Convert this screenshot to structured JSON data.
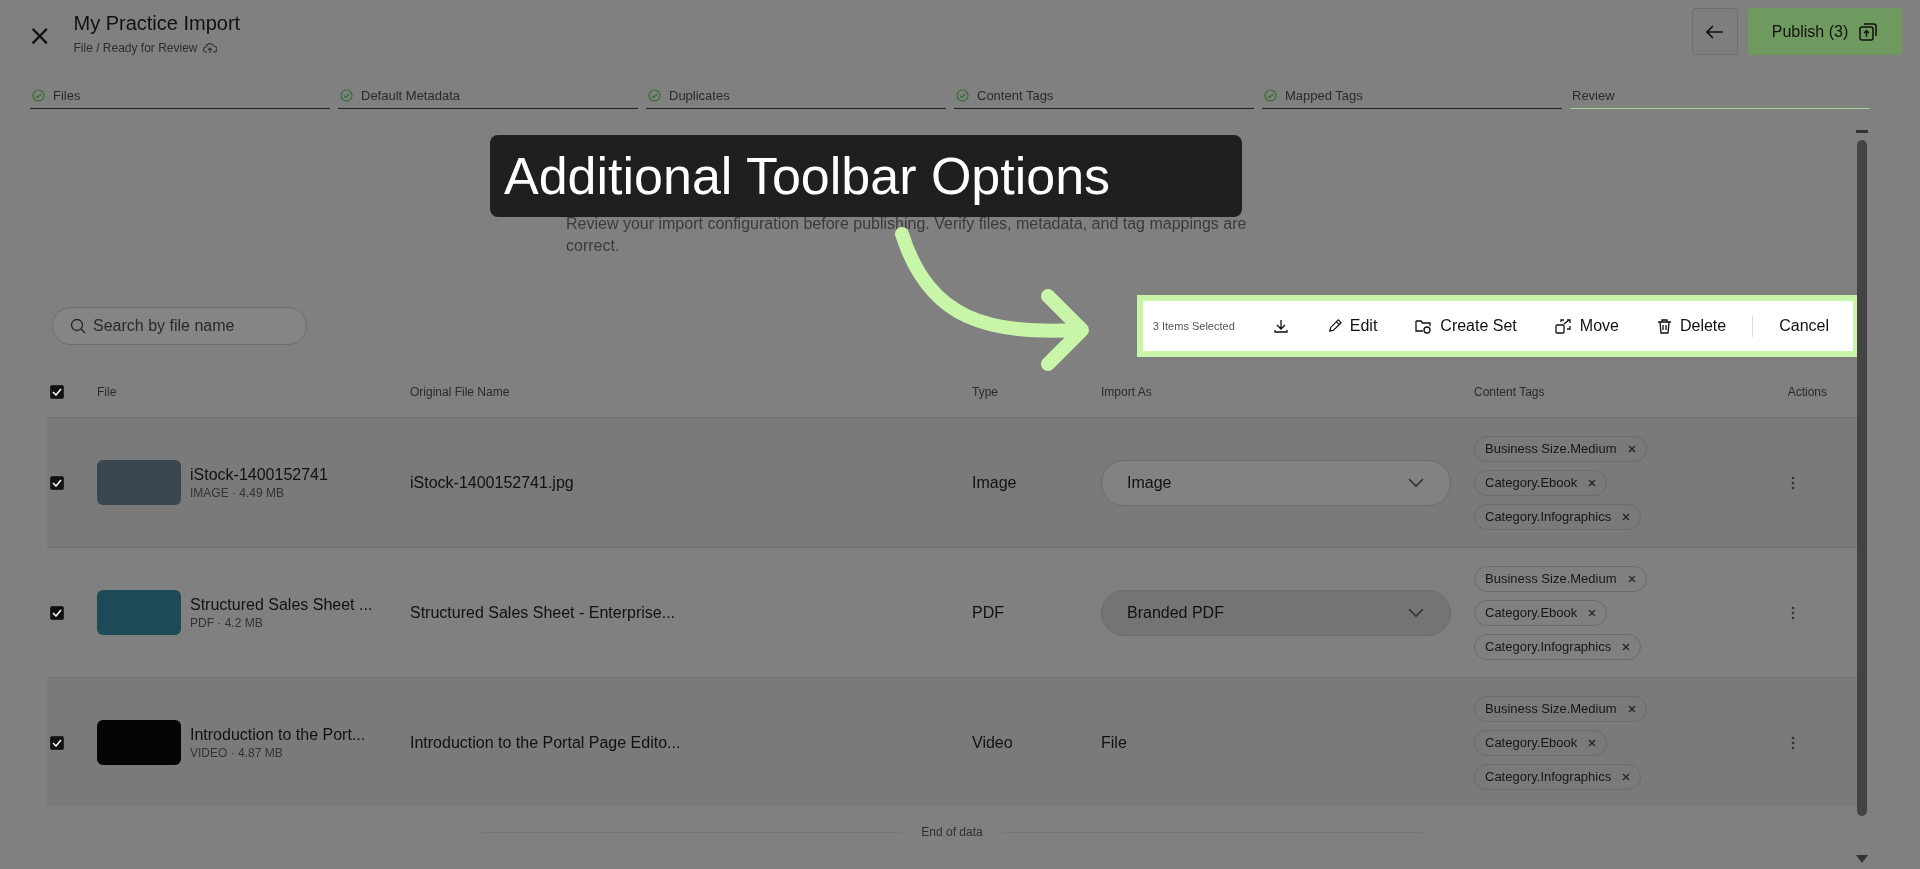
{
  "header": {
    "close": "×",
    "title": "My Practice Import",
    "breadcrumb": "File / Ready for Review",
    "publish_label": "Publish (3)"
  },
  "steps": [
    {
      "label": "Files",
      "done": true,
      "selected": false
    },
    {
      "label": "Default Metadata",
      "done": true,
      "selected": false
    },
    {
      "label": "Duplicates",
      "done": true,
      "selected": false
    },
    {
      "label": "Content Tags",
      "done": true,
      "selected": false
    },
    {
      "label": "Mapped Tags",
      "done": true,
      "selected": false
    },
    {
      "label": "Review",
      "done": false,
      "selected": true
    }
  ],
  "callout": {
    "text": "Additional Toolbar Options"
  },
  "description": "Review your import configuration before publishing. Verify files, metadata, and tag mappings are correct.",
  "search": {
    "placeholder": "Search by file name"
  },
  "toolbar": {
    "selection": "3 Items Selected",
    "actions": [
      "Edit",
      "Create Set",
      "Move",
      "Delete"
    ],
    "cancel": "Cancel"
  },
  "table": {
    "all_checked": true,
    "columns": [
      "File",
      "Original File Name",
      "Type",
      "Import As",
      "Content Tags",
      "Actions"
    ],
    "rows": [
      {
        "checked": true,
        "thumbnail": {
          "kind": "photo"
        },
        "name": "iStock-1400152741",
        "meta": "IMAGE · 4.49 MB",
        "original": "iStock-1400152741.jpg",
        "type": "Image",
        "import_as": {
          "kind": "dropdown",
          "value": "Image"
        },
        "tags": [
          "Business Size.Medium",
          "Category.Ebook",
          "Category.Infographics"
        ]
      },
      {
        "checked": true,
        "thumbnail": {
          "kind": "document"
        },
        "name": "Structured Sales Sheet ...",
        "meta": "PDF · 4.2 MB",
        "original": "Structured Sales Sheet - Enterprise...",
        "type": "PDF",
        "import_as": {
          "kind": "dropdown",
          "value": "Branded PDF"
        },
        "tags": [
          "Business Size.Medium",
          "Category.Ebook",
          "Category.Infographics"
        ]
      },
      {
        "checked": true,
        "thumbnail": {
          "kind": "video"
        },
        "name": "Introduction to the Port...",
        "meta": "VIDEO · 4.87 MB",
        "original": "Introduction to the Portal Page Edito...",
        "type": "Video",
        "import_as": {
          "kind": "text",
          "value": "File"
        },
        "tags": [
          "Business Size.Medium",
          "Category.Ebook",
          "Category.Infographics"
        ]
      }
    ],
    "end_text": "End of data"
  }
}
